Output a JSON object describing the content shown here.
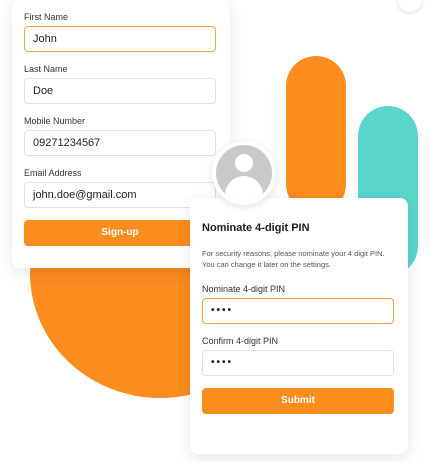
{
  "signup_form": {
    "first_name": {
      "label": "First Name",
      "value": "John"
    },
    "last_name": {
      "label": "Last Name",
      "value": "Doe"
    },
    "mobile_number": {
      "label": "Mobile Number",
      "value": "09271234567"
    },
    "email_address": {
      "label": "Email Address",
      "value": "john.doe@gmail.com"
    },
    "signup_button": "Sign-up"
  },
  "pin_form": {
    "title": "Nominate 4-digit PIN",
    "description": "For security reasons, please nominate your 4 digit PIN. You can change it later on the settings.",
    "pin": {
      "label": "Nominate 4-digit PIN",
      "value": "••••"
    },
    "confirm_pin": {
      "label": "Confirm 4-digit PIN",
      "value": "••••"
    },
    "submit_button": "Submit"
  },
  "avatar_icon": "user-avatar-icon",
  "colors": {
    "accent_orange": "#fb8c1e",
    "accent_teal": "#5ad6cd",
    "focus_border": "#f5a13f"
  }
}
